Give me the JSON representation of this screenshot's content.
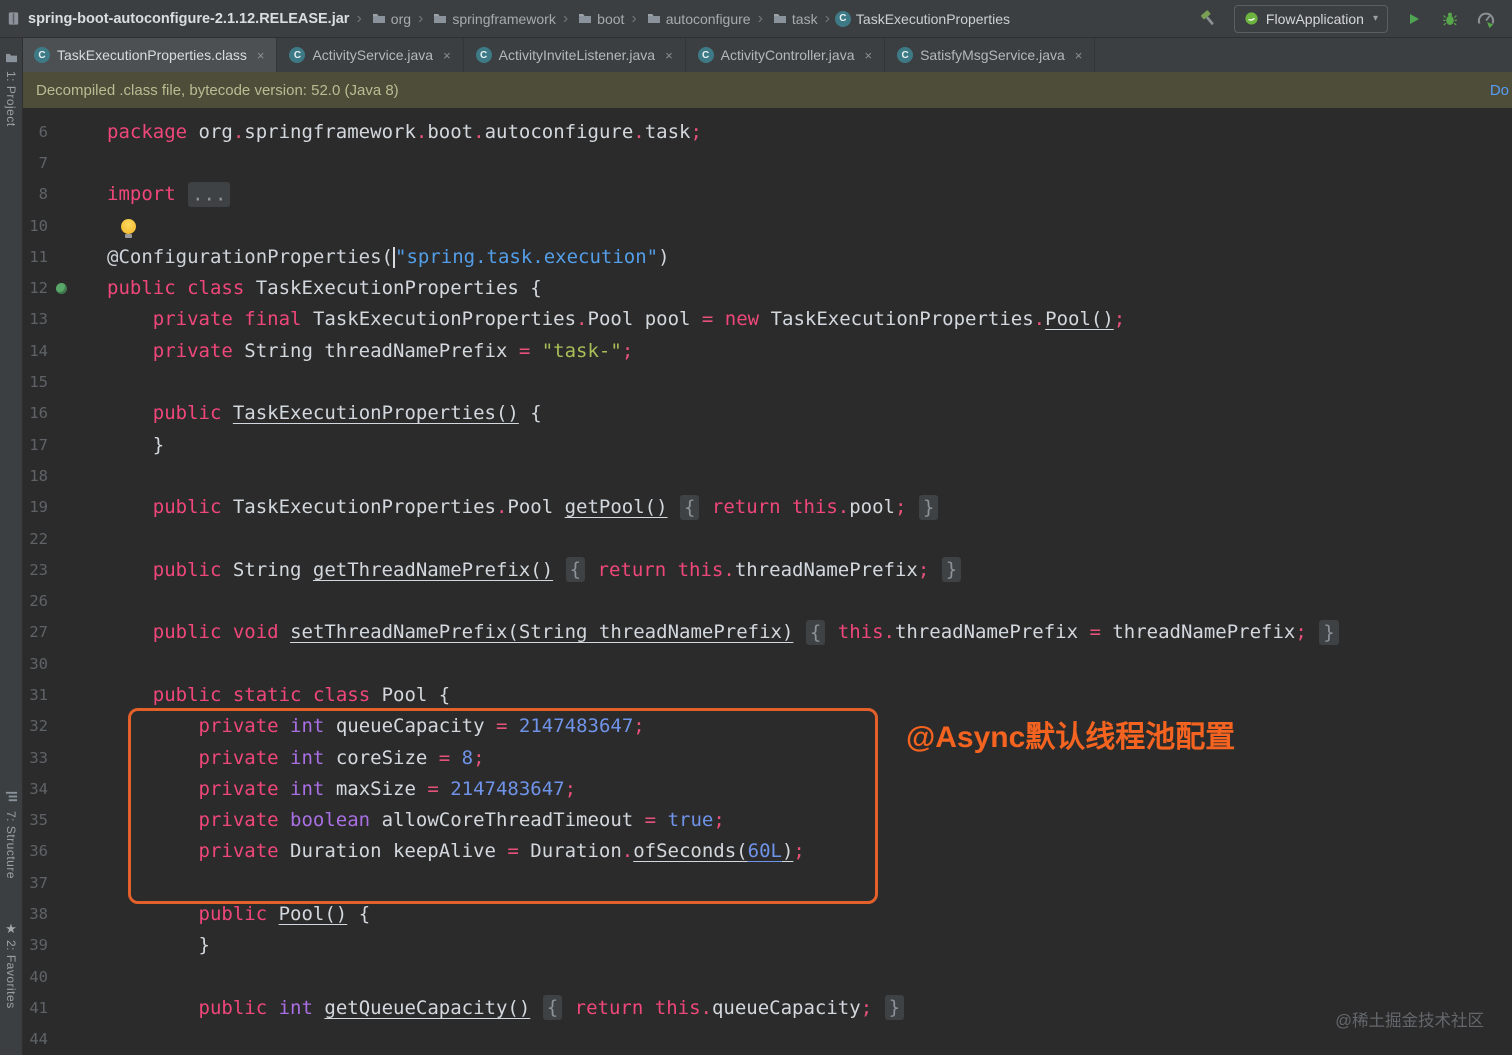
{
  "colors": {
    "editor_bg": "#2b2b2b",
    "bar_bg": "#3c3f41",
    "keyword": "#f0477a",
    "operator": "#e8517a",
    "primitive": "#a96fe3",
    "number": "#6f93e8",
    "string_green": "#a9bf57",
    "string_blue": "#539ee8",
    "code_text": "#d3d8de",
    "line_number": "#5f6367",
    "fold_bg": "#3e4244",
    "fold_text": "#8d939a",
    "banner_bg": "#4d4d3a",
    "banner_text": "#b9bd92",
    "link_blue": "#589df6",
    "accent_orange": "#f4631f",
    "box_orange": "#e4602a",
    "bean_green": "#59a869",
    "run_green": "#4fa554",
    "bulb_yellow": "#f0b429"
  },
  "navbar": {
    "jar_name": "spring-boot-autoconfigure-2.1.12.RELEASE.jar",
    "path": [
      "org",
      "springframework",
      "boot",
      "autoconfigure",
      "task"
    ],
    "class_name": "TaskExecutionProperties",
    "class_icon_letter": "C",
    "run_config": "FlowApplication"
  },
  "tabs": [
    {
      "label": "TaskExecutionProperties.class",
      "active": true
    },
    {
      "label": "ActivityService.java",
      "active": false
    },
    {
      "label": "ActivityInviteListener.java",
      "active": false
    },
    {
      "label": "ActivityController.java",
      "active": false
    },
    {
      "label": "SatisfyMsgService.java",
      "active": false
    }
  ],
  "tab_close_glyph": "×",
  "banner": {
    "text": "Decompiled .class file, bytecode version: 52.0 (Java 8)",
    "link_label": "Do"
  },
  "stripes": {
    "project": "1: Project",
    "structure": "7: Structure",
    "favorites": "2: Favorites",
    "favorites_star": "★"
  },
  "overlay": {
    "note": "@Async默认线程池配置"
  },
  "watermark": {
    "text": "@稀土掘金技术社区"
  },
  "code": {
    "lines": [
      {
        "n": 6,
        "t": [
          [
            "kw",
            "package"
          ],
          [
            "pl",
            " org"
          ],
          [
            "op",
            "."
          ],
          [
            "pl",
            "springframework"
          ],
          [
            "op",
            "."
          ],
          [
            "pl",
            "boot"
          ],
          [
            "op",
            "."
          ],
          [
            "pl",
            "autoconfigure"
          ],
          [
            "op",
            "."
          ],
          [
            "pl",
            "task"
          ],
          [
            "op",
            ";"
          ]
        ]
      },
      {
        "n": 7,
        "t": []
      },
      {
        "n": 8,
        "t": [
          [
            "kw",
            "import"
          ],
          [
            "pl",
            " "
          ],
          [
            "fold",
            "..."
          ]
        ]
      },
      {
        "n": 10,
        "t": [
          [
            "pl",
            " "
          ],
          [
            "bulb",
            ""
          ]
        ]
      },
      {
        "n": 11,
        "t": [
          [
            "ann",
            "@ConfigurationProperties"
          ],
          [
            "pl",
            "("
          ],
          [
            "caret",
            ""
          ],
          [
            "strb",
            "\"spring.task.execution\""
          ],
          [
            "pl",
            ")"
          ]
        ]
      },
      {
        "n": 12,
        "gutter": "bean",
        "t": [
          [
            "kw",
            "public"
          ],
          [
            "pl",
            " "
          ],
          [
            "kw",
            "class"
          ],
          [
            "pl",
            " TaskExecutionProperties "
          ],
          [
            "pl",
            "{"
          ]
        ]
      },
      {
        "n": 13,
        "t": [
          [
            "pl",
            "    "
          ],
          [
            "kw",
            "private"
          ],
          [
            "pl",
            " "
          ],
          [
            "kw",
            "final"
          ],
          [
            "pl",
            " TaskExecutionProperties"
          ],
          [
            "op",
            "."
          ],
          [
            "pl",
            "Pool pool "
          ],
          [
            "op",
            "="
          ],
          [
            "pl",
            " "
          ],
          [
            "kw",
            "new"
          ],
          [
            "pl",
            " TaskExecutionProperties"
          ],
          [
            "op",
            "."
          ],
          [
            "call",
            "Pool()"
          ],
          [
            "op",
            ";"
          ]
        ]
      },
      {
        "n": 14,
        "t": [
          [
            "pl",
            "    "
          ],
          [
            "kw",
            "private"
          ],
          [
            "pl",
            " String threadNamePrefix "
          ],
          [
            "op",
            "="
          ],
          [
            "pl",
            " "
          ],
          [
            "str",
            "\"task-\""
          ],
          [
            "op",
            ";"
          ]
        ]
      },
      {
        "n": 15,
        "t": []
      },
      {
        "n": 16,
        "t": [
          [
            "pl",
            "    "
          ],
          [
            "kw",
            "public"
          ],
          [
            "pl",
            " "
          ],
          [
            "mth",
            "TaskExecutionProperties()"
          ],
          [
            "pl",
            " {"
          ]
        ]
      },
      {
        "n": 17,
        "t": [
          [
            "pl",
            "    }"
          ]
        ]
      },
      {
        "n": 18,
        "t": []
      },
      {
        "n": 19,
        "t": [
          [
            "pl",
            "    "
          ],
          [
            "kw",
            "public"
          ],
          [
            "pl",
            " TaskExecutionProperties"
          ],
          [
            "op",
            "."
          ],
          [
            "pl",
            "Pool "
          ],
          [
            "mth",
            "getPool()"
          ],
          [
            "pl",
            " "
          ],
          [
            "fold",
            "{"
          ],
          [
            "pl",
            " "
          ],
          [
            "kw",
            "return"
          ],
          [
            "pl",
            " "
          ],
          [
            "kw",
            "this"
          ],
          [
            "op",
            "."
          ],
          [
            "pl",
            "pool"
          ],
          [
            "op",
            ";"
          ],
          [
            "pl",
            " "
          ],
          [
            "fold",
            "}"
          ]
        ]
      },
      {
        "n": 22,
        "t": []
      },
      {
        "n": 23,
        "t": [
          [
            "pl",
            "    "
          ],
          [
            "kw",
            "public"
          ],
          [
            "pl",
            " String "
          ],
          [
            "mth",
            "getThreadNamePrefix()"
          ],
          [
            "pl",
            " "
          ],
          [
            "fold",
            "{"
          ],
          [
            "pl",
            " "
          ],
          [
            "kw",
            "return"
          ],
          [
            "pl",
            " "
          ],
          [
            "kw",
            "this"
          ],
          [
            "op",
            "."
          ],
          [
            "pl",
            "threadNamePrefix"
          ],
          [
            "op",
            ";"
          ],
          [
            "pl",
            " "
          ],
          [
            "fold",
            "}"
          ]
        ]
      },
      {
        "n": 26,
        "t": []
      },
      {
        "n": 27,
        "t": [
          [
            "pl",
            "    "
          ],
          [
            "kw",
            "public"
          ],
          [
            "pl",
            " "
          ],
          [
            "kw",
            "void"
          ],
          [
            "pl",
            " "
          ],
          [
            "mth",
            "setThreadNamePrefix(String threadNamePrefix)"
          ],
          [
            "pl",
            " "
          ],
          [
            "fold",
            "{"
          ],
          [
            "pl",
            " "
          ],
          [
            "kw",
            "this"
          ],
          [
            "op",
            "."
          ],
          [
            "pl",
            "threadNamePrefix "
          ],
          [
            "op",
            "="
          ],
          [
            "pl",
            " threadNamePrefix"
          ],
          [
            "op",
            ";"
          ],
          [
            "pl",
            " "
          ],
          [
            "fold",
            "}"
          ]
        ]
      },
      {
        "n": 30,
        "t": []
      },
      {
        "n": 31,
        "t": [
          [
            "pl",
            "    "
          ],
          [
            "kw",
            "public"
          ],
          [
            "pl",
            " "
          ],
          [
            "kw",
            "static"
          ],
          [
            "pl",
            " "
          ],
          [
            "kw",
            "class"
          ],
          [
            "pl",
            " Pool "
          ],
          [
            "pl",
            "{"
          ]
        ]
      },
      {
        "n": 32,
        "t": [
          [
            "pl",
            "        "
          ],
          [
            "kw",
            "private"
          ],
          [
            "pl",
            " "
          ],
          [
            "prim",
            "int"
          ],
          [
            "pl",
            " queueCapacity "
          ],
          [
            "op",
            "="
          ],
          [
            "pl",
            " "
          ],
          [
            "num",
            "2147483647"
          ],
          [
            "op",
            ";"
          ]
        ]
      },
      {
        "n": 33,
        "t": [
          [
            "pl",
            "        "
          ],
          [
            "kw",
            "private"
          ],
          [
            "pl",
            " "
          ],
          [
            "prim",
            "int"
          ],
          [
            "pl",
            " coreSize "
          ],
          [
            "op",
            "="
          ],
          [
            "pl",
            " "
          ],
          [
            "num",
            "8"
          ],
          [
            "op",
            ";"
          ]
        ]
      },
      {
        "n": 34,
        "t": [
          [
            "pl",
            "        "
          ],
          [
            "kw",
            "private"
          ],
          [
            "pl",
            " "
          ],
          [
            "prim",
            "int"
          ],
          [
            "pl",
            " maxSize "
          ],
          [
            "op",
            "="
          ],
          [
            "pl",
            " "
          ],
          [
            "num",
            "2147483647"
          ],
          [
            "op",
            ";"
          ]
        ]
      },
      {
        "n": 35,
        "t": [
          [
            "pl",
            "        "
          ],
          [
            "kw",
            "private"
          ],
          [
            "pl",
            " "
          ],
          [
            "prim",
            "boolean"
          ],
          [
            "pl",
            " allowCoreThreadTimeout "
          ],
          [
            "op",
            "="
          ],
          [
            "pl",
            " "
          ],
          [
            "num",
            "true"
          ],
          [
            "op",
            ";"
          ]
        ]
      },
      {
        "n": 36,
        "t": [
          [
            "pl",
            "        "
          ],
          [
            "kw",
            "private"
          ],
          [
            "pl",
            " Duration keepAlive "
          ],
          [
            "op",
            "="
          ],
          [
            "pl",
            " Duration"
          ],
          [
            "op",
            "."
          ],
          [
            "call",
            "ofSeconds("
          ],
          [
            "numu",
            "60L"
          ],
          [
            "call",
            ")"
          ],
          [
            "op",
            ";"
          ]
        ]
      },
      {
        "n": 37,
        "t": []
      },
      {
        "n": 38,
        "t": [
          [
            "pl",
            "        "
          ],
          [
            "kw",
            "public"
          ],
          [
            "pl",
            " "
          ],
          [
            "mth",
            "Pool()"
          ],
          [
            "pl",
            " {"
          ]
        ]
      },
      {
        "n": 39,
        "t": [
          [
            "pl",
            "        }"
          ]
        ]
      },
      {
        "n": 40,
        "t": []
      },
      {
        "n": 41,
        "t": [
          [
            "pl",
            "        "
          ],
          [
            "kw",
            "public"
          ],
          [
            "pl",
            " "
          ],
          [
            "prim",
            "int"
          ],
          [
            "pl",
            " "
          ],
          [
            "mth",
            "getQueueCapacity()"
          ],
          [
            "pl",
            " "
          ],
          [
            "fold",
            "{"
          ],
          [
            "pl",
            " "
          ],
          [
            "kw",
            "return"
          ],
          [
            "pl",
            " "
          ],
          [
            "kw",
            "this"
          ],
          [
            "op",
            "."
          ],
          [
            "pl",
            "queueCapacity"
          ],
          [
            "op",
            ";"
          ],
          [
            "pl",
            " "
          ],
          [
            "fold",
            "}"
          ]
        ]
      },
      {
        "n": 44,
        "t": []
      }
    ]
  }
}
